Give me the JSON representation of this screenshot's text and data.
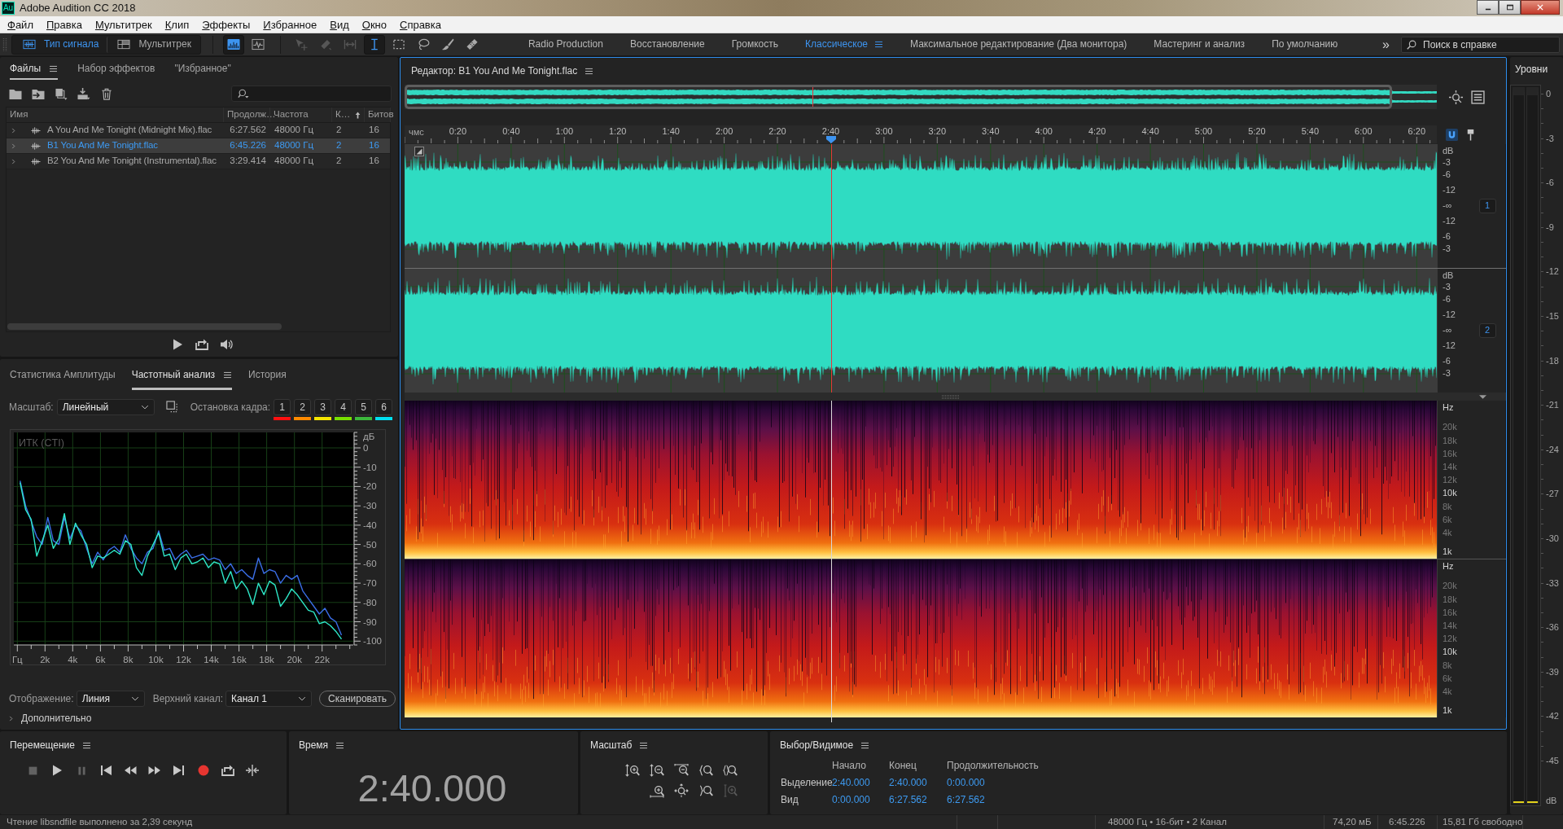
{
  "window": {
    "app_icon": "Au",
    "title": "Adobe Audition CC 2018"
  },
  "menu": [
    "Файл",
    "Правка",
    "Мультитрек",
    "Клип",
    "Эффекты",
    "Избранное",
    "Вид",
    "Окно",
    "Справка"
  ],
  "toolbar": {
    "views": [
      {
        "kind": "waveform",
        "label": "Тип сигнала",
        "selected": true
      },
      {
        "kind": "multitrack",
        "label": "Мультитрек",
        "selected": false
      }
    ],
    "display_modes": [
      {
        "kind": "waveform",
        "selected": true
      },
      {
        "kind": "spectral",
        "selected": false
      }
    ],
    "tools": [
      {
        "kind": "move",
        "selected": false,
        "disabled": true
      },
      {
        "kind": "razor",
        "selected": false,
        "disabled": true
      },
      {
        "kind": "slip",
        "selected": false,
        "disabled": true
      },
      {
        "kind": "time-selection",
        "selected": true,
        "disabled": false
      },
      {
        "kind": "marquee",
        "selected": false,
        "disabled": false
      },
      {
        "kind": "lasso",
        "selected": false,
        "disabled": false
      },
      {
        "kind": "brush",
        "selected": false,
        "disabled": false
      },
      {
        "kind": "healing",
        "selected": false,
        "disabled": false
      }
    ],
    "workspaces": [
      {
        "label": "Radio Production",
        "selected": false
      },
      {
        "label": "Восстановление",
        "selected": false
      },
      {
        "label": "Громкость",
        "selected": false
      },
      {
        "label": "Классическое",
        "selected": true
      },
      {
        "label": "Максимальное редактирование (Два монитора)",
        "selected": false
      },
      {
        "label": "Мастеринг и анализ",
        "selected": false
      },
      {
        "label": "По умолчанию",
        "selected": false
      }
    ],
    "more": "»",
    "help_search": {
      "placeholder": "Поиск в справке"
    }
  },
  "files_panel": {
    "tabs": [
      {
        "label": "Файлы",
        "selected": true
      },
      {
        "label": "Набор эффектов",
        "selected": false
      },
      {
        "label": "\"Избранное\"",
        "selected": false
      }
    ],
    "columns": [
      {
        "label": "Имя",
        "sorted": false
      },
      {
        "label": "Продолж…",
        "sorted": false
      },
      {
        "label": "Частота",
        "sorted": false
      },
      {
        "label": "К…",
        "sorted": true
      },
      {
        "label": "Битов",
        "sorted": false
      }
    ],
    "rows": [
      {
        "name": "A You And Me Tonight (Midnight Mix).flac",
        "duration": "6:27.562",
        "rate": "48000 Гц",
        "channels": "2",
        "bits": "16",
        "expanded": false,
        "selected": false
      },
      {
        "name": "B1 You And Me Tonight.flac",
        "duration": "6:45.226",
        "rate": "48000 Гц",
        "channels": "2",
        "bits": "16",
        "expanded": false,
        "selected": true
      },
      {
        "name": "B2 You And Me Tonight (Instrumental).flac",
        "duration": "3:29.414",
        "rate": "48000 Гц",
        "channels": "2",
        "bits": "16",
        "expanded": false,
        "selected": false
      }
    ]
  },
  "analysis_panel": {
    "tabs": [
      {
        "label": "Статистика Амплитуды",
        "selected": false
      },
      {
        "label": "Частотный анализ",
        "selected": true
      },
      {
        "label": "История",
        "selected": false
      }
    ],
    "scale": {
      "label": "Масштаб:",
      "value": "Линейный"
    },
    "freeze_label": "Остановка кадра:",
    "freeze_buttons": [
      {
        "label": "1",
        "color": "#ff1010"
      },
      {
        "label": "2",
        "color": "#ff8a00"
      },
      {
        "label": "3",
        "color": "#f5e600"
      },
      {
        "label": "4",
        "color": "#78e000"
      },
      {
        "label": "5",
        "color": "#3cb83c"
      },
      {
        "label": "6",
        "color": "#00e0f0"
      }
    ],
    "chart_data": {
      "type": "line",
      "title": "ИТК (CTI)",
      "ylabel": "дБ",
      "grid": true,
      "xlim": [
        -250,
        24250
      ],
      "ylim": [
        -102,
        8
      ],
      "xticks": [
        {
          "value": 0,
          "label": "Гц"
        },
        {
          "value": 2000,
          "label": "2k"
        },
        {
          "value": 4000,
          "label": "4k"
        },
        {
          "value": 6000,
          "label": "6k"
        },
        {
          "value": 8000,
          "label": "8k"
        },
        {
          "value": 10000,
          "label": "10k"
        },
        {
          "value": 12000,
          "label": "12k"
        },
        {
          "value": 14000,
          "label": "14k"
        },
        {
          "value": 16000,
          "label": "16k"
        },
        {
          "value": 18000,
          "label": "18k"
        },
        {
          "value": 20000,
          "label": "20k"
        },
        {
          "value": 22000,
          "label": "22k"
        }
      ],
      "yticks": [
        0,
        -10,
        -20,
        -30,
        -40,
        -50,
        -60,
        -70,
        -80,
        -90,
        -100
      ],
      "x": [
        200,
        600,
        1000,
        1400,
        1800,
        2200,
        2600,
        3000,
        3400,
        3800,
        4200,
        4600,
        5000,
        5400,
        5800,
        6200,
        6600,
        7000,
        7400,
        7800,
        8200,
        8600,
        9000,
        9400,
        9800,
        10200,
        10600,
        11000,
        11400,
        11800,
        12200,
        12600,
        13000,
        13400,
        13800,
        14200,
        14600,
        15000,
        15400,
        15800,
        16200,
        16600,
        17000,
        17400,
        17800,
        18200,
        18600,
        19000,
        19400,
        19800,
        20200,
        20600,
        21000,
        21400,
        21800,
        22200,
        22600,
        23000,
        23400
      ],
      "series": [
        {
          "color": "#3b6ee6",
          "values": [
            -17,
            -30,
            -38,
            -46,
            -50,
            -36,
            -48,
            -50,
            -36,
            -47,
            -40,
            -43,
            -52,
            -60,
            -54,
            -58,
            -53,
            -51,
            -54,
            -45,
            -52,
            -57,
            -60,
            -54,
            -52,
            -43,
            -53,
            -52,
            -58,
            -55,
            -53,
            -57,
            -56,
            -55,
            -58,
            -57,
            -58,
            -63,
            -60,
            -65,
            -63,
            -66,
            -68,
            -57,
            -65,
            -63,
            -64,
            -70,
            -66,
            -68,
            -66,
            -74,
            -78,
            -82,
            -86,
            -83,
            -88,
            -90,
            -97
          ]
        },
        {
          "color": "#2ee8c8",
          "values": [
            -18,
            -32,
            -37,
            -56,
            -48,
            -40,
            -52,
            -47,
            -34,
            -50,
            -39,
            -45,
            -50,
            -62,
            -56,
            -57,
            -55,
            -53,
            -55,
            -48,
            -50,
            -62,
            -66,
            -56,
            -50,
            -44,
            -56,
            -55,
            -63,
            -57,
            -55,
            -60,
            -59,
            -57,
            -62,
            -59,
            -60,
            -70,
            -64,
            -73,
            -69,
            -73,
            -81,
            -70,
            -76,
            -69,
            -71,
            -82,
            -78,
            -73,
            -76,
            -80,
            -84,
            -85,
            -91,
            -90,
            -92,
            -95,
            -99
          ]
        }
      ]
    },
    "display": {
      "label": "Отображение:",
      "value": "Линия"
    },
    "top_channel": {
      "label": "Верхний канал:",
      "value": "Канал 1"
    },
    "scan_button": "Сканировать",
    "advanced": {
      "label": "Дополнительно",
      "expanded": false
    }
  },
  "editor": {
    "title": "Редактор: B1 You And Me Tonight.flac",
    "playhead": {
      "level": 0.413
    },
    "ruler": {
      "unit": "чмс",
      "labels": [
        "0:20",
        "0:40",
        "1:00",
        "1:20",
        "1:40",
        "2:00",
        "2:20",
        "2:40",
        "3:00",
        "3:20",
        "3:40",
        "4:00",
        "4:20",
        "4:40",
        "5:00",
        "5:20",
        "5:40",
        "6:00",
        "6:20"
      ]
    },
    "waveform_channels": [
      {
        "badge": "1",
        "scale": [
          "dB",
          "-3",
          "-6",
          "-12",
          "-∞",
          "-12",
          "-6",
          "-3"
        ]
      },
      {
        "badge": "2",
        "scale": [
          "dB",
          "-3",
          "-6",
          "-12",
          "-∞",
          "-12",
          "-6",
          "-3"
        ]
      }
    ],
    "spectral_channels": [
      {
        "scale": [
          {
            "text": "Hz",
            "major": true
          },
          {
            "text": "20k",
            "major": false
          },
          {
            "text": "18k",
            "major": false
          },
          {
            "text": "16k",
            "major": false
          },
          {
            "text": "14k",
            "major": false
          },
          {
            "text": "12k",
            "major": false
          },
          {
            "text": "10k",
            "major": true
          },
          {
            "text": "8k",
            "major": false
          },
          {
            "text": "6k",
            "major": false
          },
          {
            "text": "4k",
            "major": false
          },
          {
            "text": "1k",
            "major": true
          }
        ]
      },
      {
        "scale": [
          {
            "text": "Hz",
            "major": true
          },
          {
            "text": "20k",
            "major": false
          },
          {
            "text": "18k",
            "major": false
          },
          {
            "text": "16k",
            "major": false
          },
          {
            "text": "14k",
            "major": false
          },
          {
            "text": "12k",
            "major": false
          },
          {
            "text": "10k",
            "major": true
          },
          {
            "text": "8k",
            "major": false
          },
          {
            "text": "6k",
            "major": false
          },
          {
            "text": "4k",
            "major": false
          },
          {
            "text": "1k",
            "major": true
          }
        ]
      }
    ]
  },
  "levels_panel": {
    "title": "Уровни",
    "scale": [
      "0",
      "-3",
      "-6",
      "-9",
      "-12",
      "-15",
      "-18",
      "-21",
      "-24",
      "-27",
      "-30",
      "-33",
      "-36",
      "-39",
      "-42",
      "-45"
    ],
    "unit": "dB",
    "meters": [
      {
        "level": 0
      },
      {
        "level": 0
      }
    ]
  },
  "transport": {
    "title": "Перемещение",
    "buttons": [
      {
        "kind": "stop",
        "disabled": true
      },
      {
        "kind": "play",
        "disabled": false
      },
      {
        "kind": "pause",
        "disabled": true
      },
      {
        "kind": "to-start",
        "disabled": false
      },
      {
        "kind": "rewind",
        "disabled": false
      },
      {
        "kind": "fast-forward",
        "disabled": false
      },
      {
        "kind": "to-end",
        "disabled": false
      },
      {
        "kind": "record",
        "disabled": false
      },
      {
        "kind": "loop",
        "disabled": false
      },
      {
        "kind": "skip",
        "disabled": false
      }
    ]
  },
  "time_panel": {
    "title": "Время",
    "value": "2:40.000"
  },
  "zoom_panel": {
    "title": "Масштаб",
    "buttons": [
      {
        "kind": "amp-in",
        "disabled": false
      },
      {
        "kind": "amp-out",
        "disabled": false
      },
      {
        "kind": "full-out",
        "disabled": false
      },
      {
        "kind": "in-point",
        "disabled": false
      },
      {
        "kind": "selection",
        "disabled": false
      },
      {
        "kind": "time-in",
        "disabled": false
      },
      {
        "kind": "all-out",
        "disabled": false
      },
      {
        "kind": "out-point",
        "disabled": false
      },
      {
        "kind": "track-in",
        "disabled": true
      }
    ]
  },
  "selection_panel": {
    "title": "Выбор/Видимое",
    "columns": [
      "Начало",
      "Конец",
      "Продолжительность"
    ],
    "rows": [
      {
        "label": "Выделение",
        "values": [
          "2:40.000",
          "2:40.000",
          "0:00.000"
        ]
      },
      {
        "label": "Вид",
        "values": [
          "0:00.000",
          "6:27.562",
          "6:27.562"
        ]
      }
    ]
  },
  "status_bar": {
    "message": "Чтение libsndfile выполнено за 2,39 секунд",
    "format": "48000 Гц • 16-бит • 2 Канал",
    "size": "74,20 мБ",
    "duration": "6:45.226",
    "free_space": "15,81 Гб свободно"
  }
}
